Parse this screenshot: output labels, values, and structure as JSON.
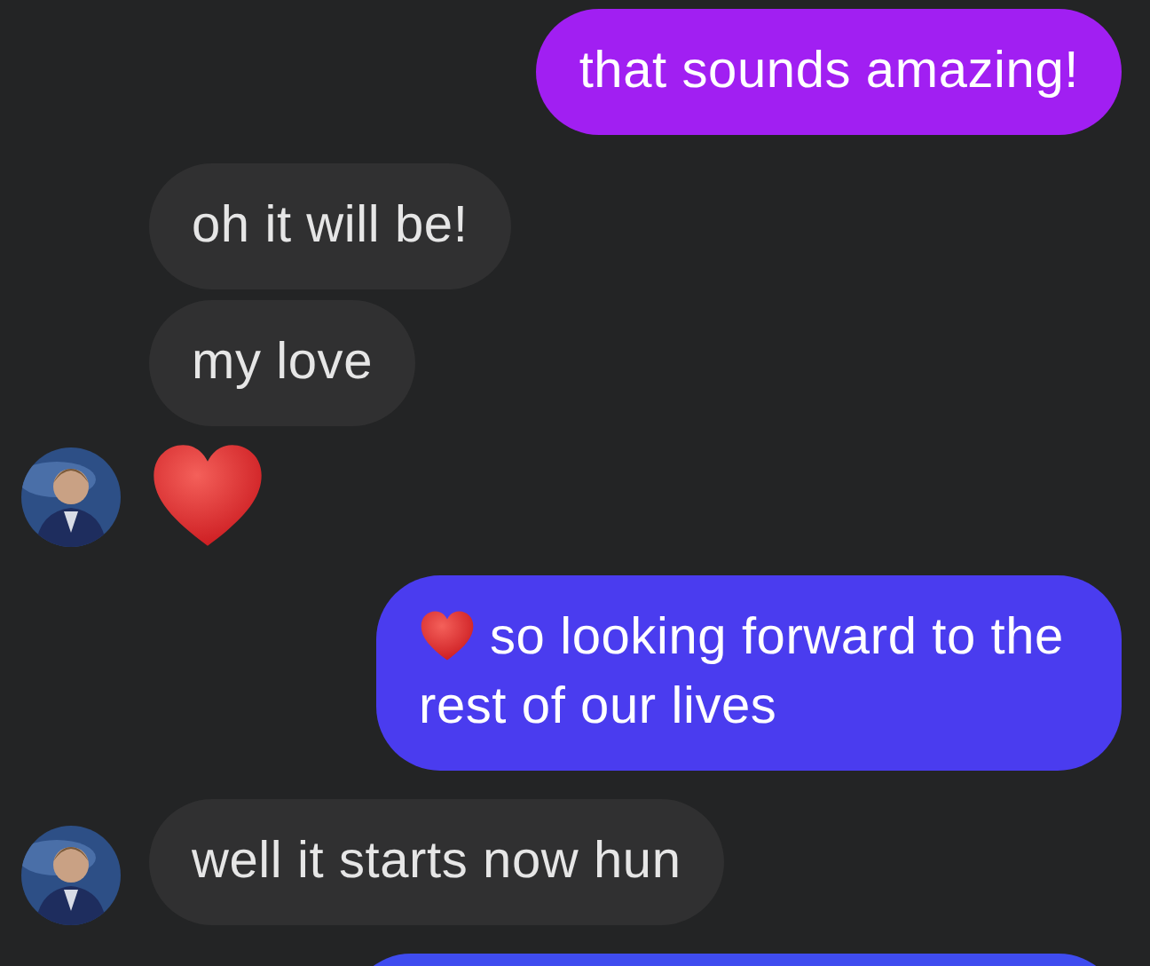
{
  "messages": [
    {
      "kind": "sent",
      "text": "that sounds amazing!",
      "color": "#a11ff2"
    },
    {
      "kind": "received",
      "text": "oh it will be!",
      "avatar": false
    },
    {
      "kind": "received",
      "text": "my love",
      "avatar": false
    },
    {
      "kind": "received_heart",
      "avatar": true
    },
    {
      "kind": "sent",
      "text": "so looking forward to the rest of our lives",
      "heart_prefix": true,
      "color": "#4a3cef"
    },
    {
      "kind": "received",
      "text": "well it starts now hun",
      "avatar": true
    },
    {
      "kind": "sent",
      "color": "#3f4cef"
    }
  ]
}
